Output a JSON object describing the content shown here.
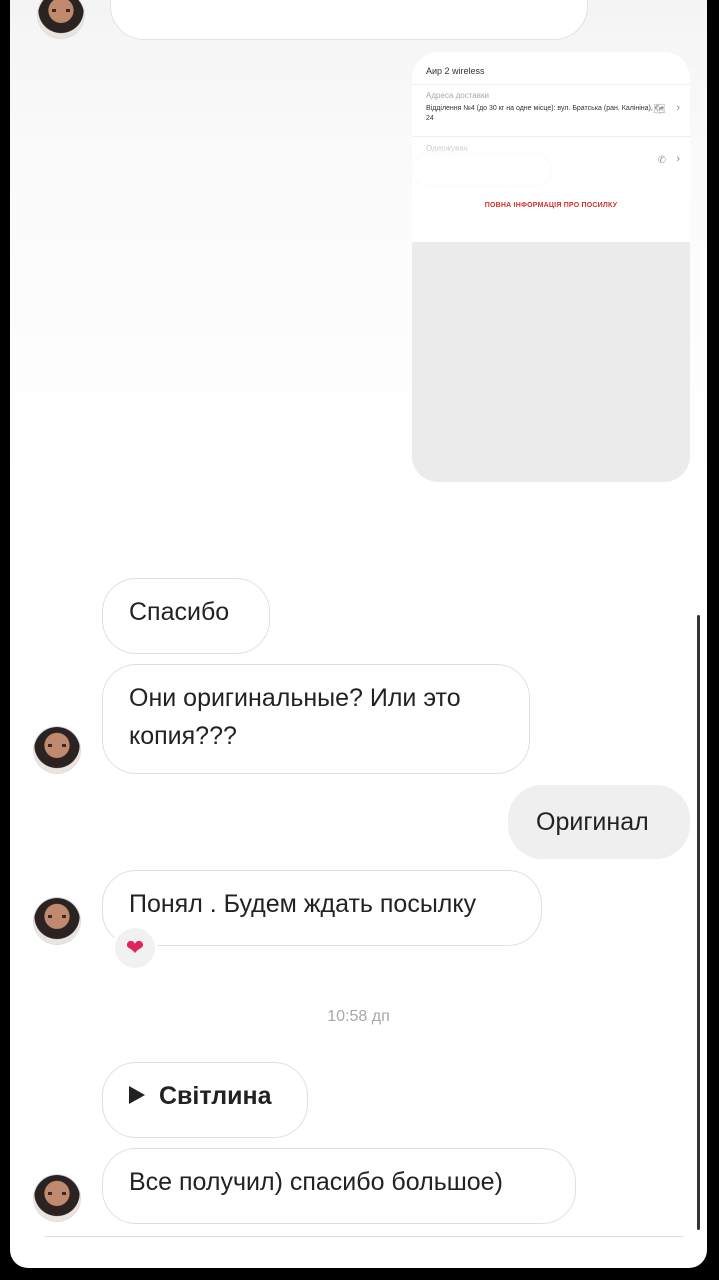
{
  "card": {
    "title": "Аир 2 wireless",
    "address_label": "Адреса доставки",
    "address_text": "Відділення №4 (до 30 кг на одне місце): вул. Братська (ран. Калініна), 24",
    "receiver_label": "Одержувач",
    "link": "ПОВНА ІНФОРМАЦІЯ ПРО ПОСИЛКУ",
    "map_icon": "🗺",
    "phone_icon": "✆",
    "chevron": "›"
  },
  "messages": {
    "m1": "Спасибо",
    "m2": "Они оригинальные? Или это копия???",
    "m3_me": "Оригинал",
    "m4": "Понял . Будем ждать посылку",
    "reaction": "❤",
    "timestamp": "10:58 дп",
    "m5_attachment": "Світлина",
    "m6": "Все получил) спасибо большое)"
  },
  "colors": {
    "accent_red": "#d0302a",
    "my_bubble": "#efefef",
    "heart": "#e0245e"
  }
}
